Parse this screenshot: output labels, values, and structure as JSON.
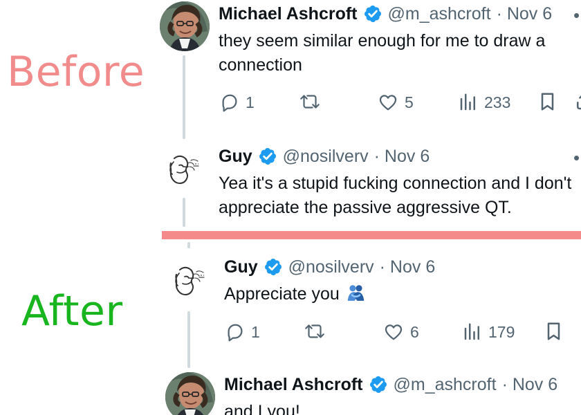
{
  "labels": {
    "before": "Before",
    "after": "After"
  },
  "colors": {
    "before_label": "#f28c8c",
    "after_label": "#19b51f",
    "divider": "#f48a8a",
    "verified": "#1d9bf0",
    "text": "#0f1419",
    "secondary": "#536471",
    "thread_line": "#cfd9de"
  },
  "before": {
    "tweet1": {
      "name": "Michael Ashcroft",
      "handle": "@m_ashcroft",
      "date": "· Nov 6",
      "text": "they seem similar enough for me to draw a connection",
      "avatar_icon": "profile-photo-icon",
      "actions": {
        "replies": "1",
        "reposts": "",
        "likes": "5",
        "views": "233"
      }
    },
    "tweet2": {
      "name": "Guy",
      "handle": "@nosilverv",
      "date": "· Nov 6",
      "text": "Yea it's a stupid fucking connection and I don't appreciate the passive aggressive QT.",
      "avatar_icon": "sketch-face-icon"
    }
  },
  "after": {
    "tweet1": {
      "name": "Guy",
      "handle": "@nosilverv",
      "date": "· Nov 6",
      "text": "Appreciate you",
      "emoji_icon": "people-hugging-icon",
      "avatar_icon": "sketch-face-icon",
      "actions": {
        "replies": "1",
        "reposts": "",
        "likes": "6",
        "views": "179"
      }
    },
    "tweet2": {
      "name": "Michael Ashcroft",
      "handle": "@m_ashcroft",
      "date": "· Nov 6",
      "text": "and I you!",
      "avatar_icon": "profile-photo-icon"
    }
  },
  "icons": {
    "verified": "verified-badge-icon",
    "reply": "reply-icon",
    "repost": "repost-icon",
    "like": "like-icon",
    "views": "views-icon",
    "bookmark": "bookmark-icon",
    "share": "share-icon",
    "more": "more-options-icon"
  }
}
